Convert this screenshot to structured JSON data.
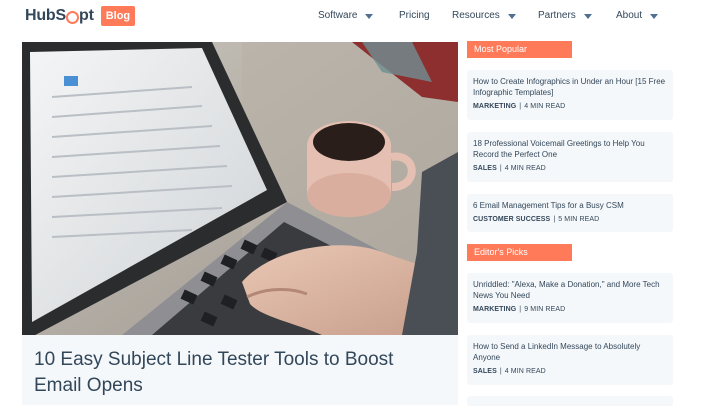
{
  "header": {
    "logo_text_a": "Hub",
    "logo_text_b": "pt",
    "logo_badge": "Blog",
    "nav": [
      {
        "label": "Software",
        "dropdown": true
      },
      {
        "label": "Pricing",
        "dropdown": false
      },
      {
        "label": "Resources",
        "dropdown": true
      },
      {
        "label": "Partners",
        "dropdown": true
      },
      {
        "label": "About",
        "dropdown": true
      }
    ]
  },
  "hero": {
    "title": "10 Easy Subject Line Tester Tools to Boost Email Opens",
    "image_icon": "laptop-coffee-photo"
  },
  "sidebar": {
    "most_popular_label": "Most Popular",
    "most_popular": [
      {
        "title": "How to Create Infographics in Under an Hour [15 Free Infographic Templates]",
        "tag": "MARKETING",
        "separator": "|",
        "read_time": "4 MIN READ"
      },
      {
        "title": "18 Professional Voicemail Greetings to Help You Record the Perfect One",
        "tag": "SALES",
        "separator": "|",
        "read_time": "4 MIN READ"
      },
      {
        "title": "6 Email Management Tips for a Busy CSM",
        "tag": "CUSTOMER SUCCESS",
        "separator": "|",
        "read_time": "5 MIN READ"
      }
    ],
    "editors_picks_label": "Editor's Picks",
    "editors_picks": [
      {
        "title": "Unriddled: \"Alexa, Make a Donation,\" and More Tech News You Need",
        "tag": "MARKETING",
        "separator": "|",
        "read_time": "9 MIN READ"
      },
      {
        "title": "How to Send a LinkedIn Message to Absolutely Anyone",
        "tag": "SALES",
        "separator": "|",
        "read_time": "4 MIN READ"
      }
    ]
  },
  "colors": {
    "brand_orange": "#ff7a59",
    "text_dark": "#33475b",
    "card_bg": "#f5f8fa"
  }
}
